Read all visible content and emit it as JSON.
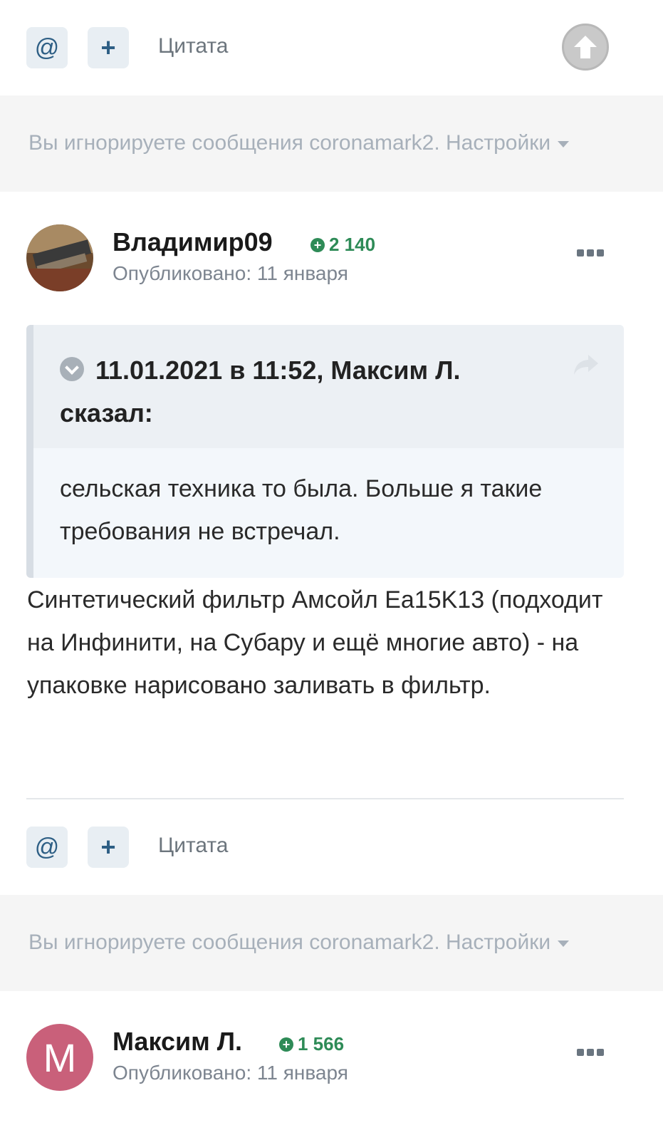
{
  "top_actions": {
    "mention_glyph": "@",
    "plus_glyph": "+",
    "quote_label": "Цитата"
  },
  "ignored_notice_1": {
    "text": "Вы игнорируете сообщения coronamark2. Настройки"
  },
  "post1": {
    "author": "Владимир09",
    "reputation": "2 140",
    "published": "Опубликовано: 11 января",
    "quote": {
      "citation": "11.01.2021 в 11:52, Максим Л. сказал:",
      "text": "сельская техника то была. Больше я такие требования не встречал."
    },
    "body": "Синтетический фильтр Амсойл Ea15K13 (подходит на Инфинити, на Субару и ещё многие авто) - на упаковке нарисовано заливать в фильтр.",
    "actions": {
      "mention_glyph": "@",
      "plus_glyph": "+",
      "quote_label": "Цитата"
    }
  },
  "ignored_notice_2": {
    "text": "Вы игнорируете сообщения coronamark2. Настройки"
  },
  "post2": {
    "author": "Максим Л.",
    "avatar_letter": "M",
    "avatar_color": "#c9607a",
    "reputation": "1 566",
    "published": "Опубликовано: 11 января"
  },
  "colors": {
    "reputation_green": "#2e8b57",
    "button_bg": "#e8eef3",
    "button_icon": "#2e5f85",
    "muted_text": "#a7b0ba"
  }
}
